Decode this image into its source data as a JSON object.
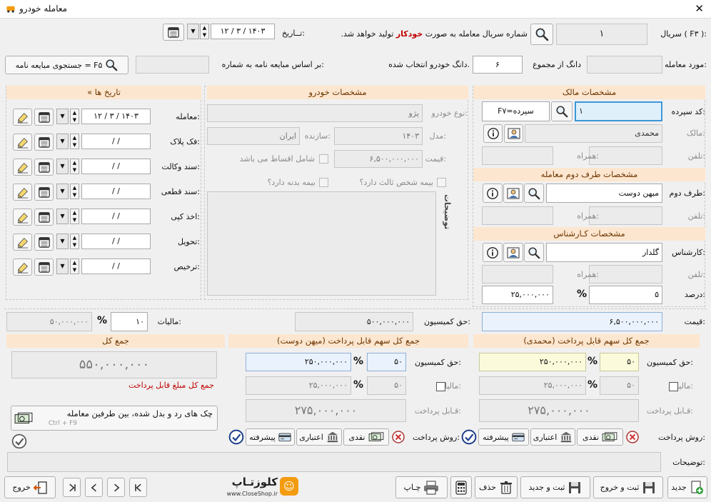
{
  "window": {
    "title": "معامله خودرو",
    "app_icon": "car-icon",
    "close": "✕"
  },
  "top": {
    "serial_label": "سریال ( F۳ ):",
    "serial_value": "۱",
    "serial_note_pre": "شماره سریال معامله به صورت",
    "serial_note_bold": "خودکار",
    "serial_note_post": "تولید خواهد شد.",
    "date_label": "تــاریخ:",
    "date_value": "۱۲ / ۳ / ۱۴۰۳"
  },
  "row2": {
    "deal_label": "مورد معامله:",
    "dong_label": "دانگ از مجموع",
    "dong_value": "۶",
    "dong_note": "دانگ خودرو انتخاب شده.",
    "contract_label": "بر اساس مبایعه نامه به شماره:",
    "search_button": "جستجوی مبایعه نامه = F۵"
  },
  "owner": {
    "header": "مشخصات مالک",
    "code_label": "کد سپرده:",
    "code_value": "۱",
    "code_hint": "F۷=سپرده",
    "owner_label": "مالک:",
    "owner_value": "محمدی",
    "phone_label": "تلفن:",
    "mobile_label": "همراه:"
  },
  "party2": {
    "header": "مشخصات طرف دوم معامله",
    "label": "طرف دوم:",
    "value": "میهن دوست",
    "phone_label": "تلفن:",
    "mobile_label": "همراه:"
  },
  "expert": {
    "header": "مشخصات کـارشناس",
    "label": "کارشناس:",
    "value": "گلدار",
    "phone_label": "تلفن:",
    "mobile_label": "همراه:",
    "percent_label": "درصد:",
    "percent_value": "۵",
    "amount_value": "۲۵,۰۰۰,۰۰۰"
  },
  "car": {
    "header": "مشخصات خودرو",
    "type_label": "نوع خودرو:",
    "type_value": "پژو",
    "model_label": "مدل:",
    "model_value": "۱۴۰۳",
    "maker_label": "سازنده:",
    "maker_value": "ایران",
    "price_label": "قیمت:",
    "price_value": "۶,۵۰۰,۰۰۰,۰۰۰",
    "installment": "شامل اقساط می باشد",
    "third_party": "بیمه شخص ثالث دارد؟",
    "body_ins": "بیمه بدنه دارد؟",
    "desc_label": "توضیحات"
  },
  "dates": {
    "header": "« تاریخ ها",
    "rows": [
      {
        "label": "معامله:",
        "value": "۱۲ / ۳ / ۱۴۰۳"
      },
      {
        "label": "فک پلاک:",
        "value": "/ /"
      },
      {
        "label": "سند وکالت:",
        "value": "/ /"
      },
      {
        "label": "سند قطعی:",
        "value": "/ /"
      },
      {
        "label": "اخذ کپی:",
        "value": "/ /"
      },
      {
        "label": "تحویل:",
        "value": "/ /"
      },
      {
        "label": "ترخیص:",
        "value": "/ /"
      }
    ]
  },
  "summary": {
    "price_label": "قیمت:",
    "price_value": "۶,۵۰۰,۰۰۰,۰۰۰",
    "commission_label": "حق کمیسیون:",
    "commission_value": "۵۰۰,۰۰۰,۰۰۰",
    "tax_label": "مالیات:",
    "tax_percent": "۱۰",
    "tax_value": "۵۰,۰۰۰,۰۰۰"
  },
  "owner_share": {
    "header": "جمع کل سهم قابل پرداخت (محمدی)",
    "commission_label": "حق کمیسیون:",
    "commission_pct": "۵۰",
    "commission_value": "۲۵۰,۰۰۰,۰۰۰",
    "tax_label": "مالیات:",
    "tax_pct": "۵۰",
    "tax_value": "۲۵,۰۰۰,۰۰۰",
    "payable_label": "قـابل پرداخت:",
    "payable_value": "۲۷۵,۰۰۰,۰۰۰"
  },
  "buyer_share": {
    "header": "جمع کل سهم قابل پرداخت (میهن دوست)",
    "commission_label": "حق کمیسیون:",
    "commission_pct": "۵۰",
    "commission_value": "۲۵۰,۰۰۰,۰۰۰",
    "tax_label": "مالیات:",
    "tax_pct": "۵۰",
    "tax_value": "۲۵,۰۰۰,۰۰۰",
    "payable_label": "قـابل پرداخت:",
    "payable_value": "۲۷۵,۰۰۰,۰۰۰"
  },
  "total": {
    "header": "جمع کل",
    "value": "۵۵۰,۰۰۰,۰۰۰",
    "note": "جمع کل مبلغ قابل پرداخت",
    "cheque_text": "چک های رد و بدل شده، بین طرفین معامله",
    "cheque_shortcut": "Ctrl + F9"
  },
  "payment": {
    "label": "روش پرداخت:",
    "label2": "روش پرداخت:",
    "cash": "نقدی",
    "credit": "اعتباری",
    "advanced": "پیشرفته"
  },
  "notes": {
    "label": "توضیحات:"
  },
  "footer": {
    "new": "جدید",
    "save_exit": "ثبت و خروج",
    "save_new": "ثبت و جدید",
    "delete": "حذف",
    "print": "چـاپ",
    "exit": "خروج",
    "logo_text": "کلوزتـاپ",
    "logo_url": "www.CloseShop.ir"
  },
  "colors": {
    "section_bg": "#fde6cf",
    "section_text": "#6b3500",
    "accent_red": "#c00000",
    "focus_border": "#3d96d8"
  }
}
